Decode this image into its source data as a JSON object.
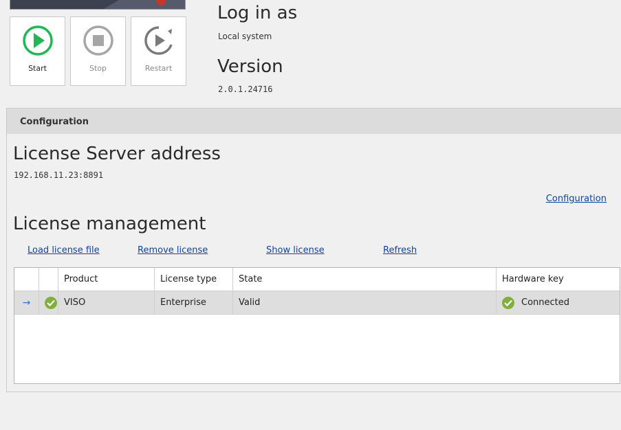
{
  "controls": {
    "start_label": "Start",
    "stop_label": "Stop",
    "restart_label": "Restart"
  },
  "service": {
    "login_title": "Log in as",
    "login_value": "Local system",
    "version_title": "Version",
    "version_value": "2.0.1.24716"
  },
  "configuration": {
    "header": "Configuration",
    "license_server_title": "License Server address",
    "license_server_value": "192.168.11.23:8891",
    "config_link": "Configuration"
  },
  "license_management": {
    "title": "License management",
    "actions": {
      "load": "Load license file",
      "remove": "Remove license",
      "show": "Show license",
      "refresh": "Refresh"
    },
    "columns": [
      "",
      "",
      "Product",
      "License type",
      "State",
      "Hardware key"
    ],
    "rows": [
      {
        "selected_indicator": "→",
        "status_icon": "check-circle-icon",
        "product": "VISO",
        "license_type": "Enterprise",
        "state": "Valid",
        "hardware_key": "Connected"
      }
    ]
  },
  "colors": {
    "start_green": "#1db954",
    "ok_green": "#7fb03a",
    "link_blue": "#0645ad",
    "header_gray": "#dcdcdc"
  }
}
